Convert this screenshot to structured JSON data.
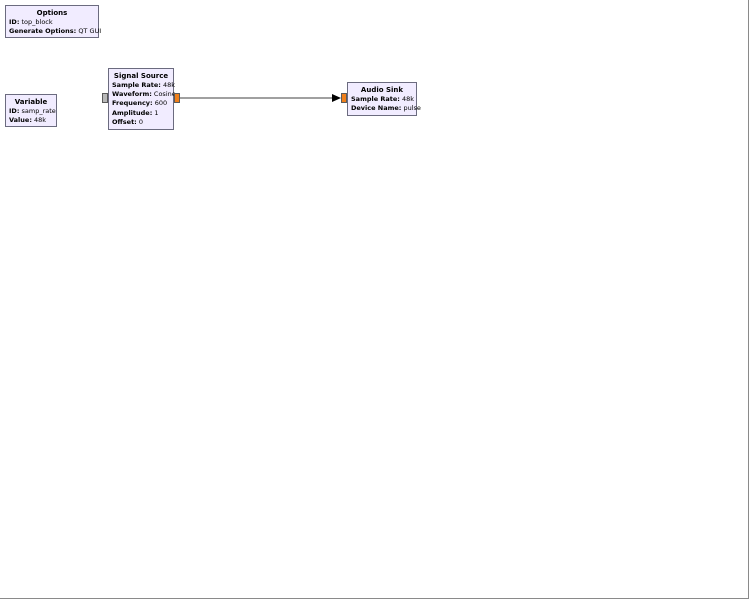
{
  "blocks": {
    "options": {
      "title": "Options",
      "params": [
        {
          "k": "ID:",
          "v": "top_block"
        },
        {
          "k": "Generate Options:",
          "v": "QT GUI"
        }
      ]
    },
    "variable": {
      "title": "Variable",
      "params": [
        {
          "k": "ID:",
          "v": "samp_rate"
        },
        {
          "k": "Value:",
          "v": "48k"
        }
      ]
    },
    "signal_source": {
      "title": "Signal Source",
      "params": [
        {
          "k": "Sample Rate:",
          "v": "48k"
        },
        {
          "k": "Waveform:",
          "v": "Cosine"
        },
        {
          "k": "Frequency:",
          "v": "600"
        },
        {
          "k": "Amplitude:",
          "v": "1"
        },
        {
          "k": "Offset:",
          "v": "0"
        }
      ]
    },
    "audio_sink": {
      "title": "Audio Sink",
      "params": [
        {
          "k": "Sample Rate:",
          "v": "48k"
        },
        {
          "k": "Device Name:",
          "v": "pulse"
        }
      ]
    }
  },
  "colors": {
    "block_fill": "#f1ecff",
    "block_border": "#6b6b7f",
    "stream_port": "#f07f1a",
    "message_port": "#b8b8b8"
  }
}
